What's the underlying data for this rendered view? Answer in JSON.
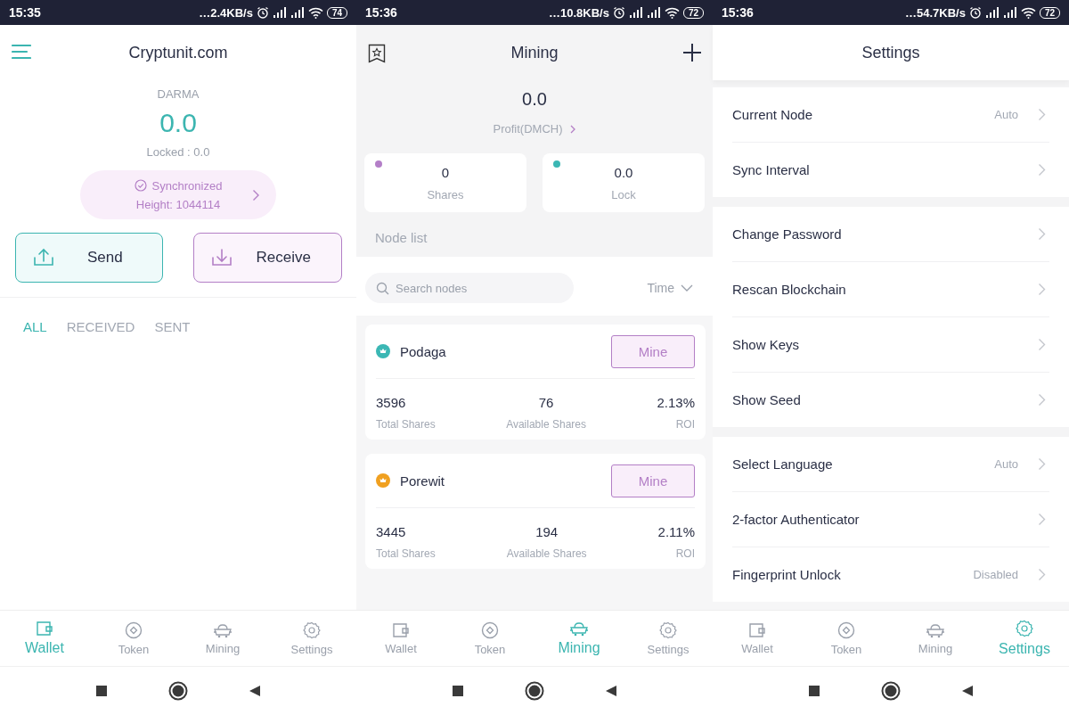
{
  "screens": [
    {
      "kind": "wallet",
      "status_bar": {
        "time": "15:35",
        "speed": "…2.4KB/s",
        "battery": "74"
      },
      "header": {
        "title": "Cryptunit.com"
      },
      "balance": {
        "currency": "DARMA",
        "amount": "0.0",
        "locked": "Locked : 0.0"
      },
      "sync": {
        "status": "Synchronized",
        "height": "Height: 1044114"
      },
      "actions": [
        {
          "label": "Send",
          "kind": "send"
        },
        {
          "label": "Receive",
          "kind": "receive"
        }
      ],
      "filters": [
        {
          "label": "ALL",
          "selected": true
        },
        {
          "label": "RECEIVED",
          "selected": false
        },
        {
          "label": "SENT",
          "selected": false
        }
      ],
      "tab_bar": [
        {
          "label": "Wallet",
          "kind": "wallet",
          "selected": true
        },
        {
          "label": "Token",
          "kind": "token",
          "selected": false
        },
        {
          "label": "Mining",
          "kind": "mining",
          "selected": false
        },
        {
          "label": "Settings",
          "kind": "settings",
          "selected": false
        }
      ]
    },
    {
      "kind": "mining",
      "status_bar": {
        "time": "15:36",
        "speed": "…10.8KB/s",
        "battery": "72"
      },
      "header": {
        "title": "Mining"
      },
      "profit": {
        "amount": "0.0",
        "label": "Profit(DMCH)"
      },
      "stats": [
        {
          "value": "0",
          "label": "Shares",
          "color": "#b47fc8"
        },
        {
          "value": "0.0",
          "label": "Lock",
          "color": "#3bb7b4"
        }
      ],
      "node_list_title": "Node list",
      "search": {
        "placeholder": "Search nodes"
      },
      "sort": "Time",
      "nodes": [
        {
          "name": "Podaga",
          "color": "#3bb7b4",
          "button": "Mine",
          "stats": [
            {
              "value": "3596",
              "label": "Total Shares"
            },
            {
              "value": "76",
              "label": "Available Shares"
            },
            {
              "value": "2.13%",
              "label": "ROI"
            }
          ]
        },
        {
          "name": "Porewit",
          "color": "#f0a020",
          "button": "Mine",
          "stats": [
            {
              "value": "3445",
              "label": "Total Shares"
            },
            {
              "value": "194",
              "label": "Available Shares"
            },
            {
              "value": "2.11%",
              "label": "ROI"
            }
          ]
        }
      ],
      "tab_bar": [
        {
          "label": "Wallet",
          "kind": "wallet",
          "selected": false
        },
        {
          "label": "Token",
          "kind": "token",
          "selected": false
        },
        {
          "label": "Mining",
          "kind": "mining",
          "selected": true
        },
        {
          "label": "Settings",
          "kind": "settings",
          "selected": false
        }
      ]
    },
    {
      "kind": "settings",
      "status_bar": {
        "time": "15:36",
        "speed": "…54.7KB/s",
        "battery": "72"
      },
      "header": {
        "title": "Settings"
      },
      "groups": [
        {
          "items": [
            {
              "label": "Current Node",
              "value": "Auto"
            },
            {
              "label": "Sync Interval"
            }
          ]
        },
        {
          "items": [
            {
              "label": "Change Password"
            },
            {
              "label": "Rescan Blockchain"
            },
            {
              "label": "Show Keys"
            },
            {
              "label": "Show Seed"
            }
          ]
        },
        {
          "items": [
            {
              "label": "Select Language",
              "value": "Auto"
            },
            {
              "label": "2-factor Authenticator"
            },
            {
              "label": "Fingerprint Unlock",
              "value": "Disabled"
            }
          ]
        }
      ],
      "tab_bar": [
        {
          "label": "Wallet",
          "kind": "wallet",
          "selected": false
        },
        {
          "label": "Token",
          "kind": "token",
          "selected": false
        },
        {
          "label": "Mining",
          "kind": "mining",
          "selected": false
        },
        {
          "label": "Settings",
          "kind": "settings",
          "selected": true
        }
      ]
    }
  ]
}
